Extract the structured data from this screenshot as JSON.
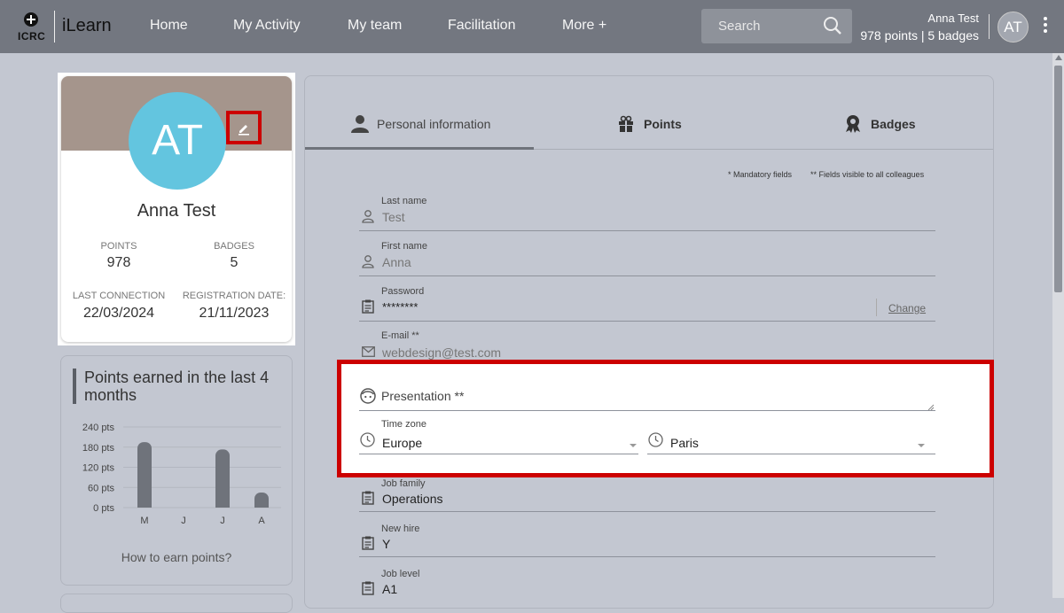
{
  "header": {
    "logo_text": "ICRC",
    "app_name": "iLearn",
    "nav": [
      "Home",
      "My Activity",
      "My team",
      "Facilitation",
      "More +"
    ],
    "search_placeholder": "Search",
    "user_name": "Anna Test",
    "user_stats": "978 points | 5 badges",
    "user_initials": "AT"
  },
  "profile": {
    "initials": "AT",
    "name": "Anna Test",
    "points_label": "POINTS",
    "points_value": "978",
    "badges_label": "BADGES",
    "badges_value": "5",
    "last_connection_label": "LAST CONNECTION",
    "last_connection_value": "22/03/2024",
    "registration_label": "REGISTRATION DATE:",
    "registration_value": "21/11/2023"
  },
  "points_widget": {
    "title": "Points earned in the last 4 months",
    "link": "How to earn points?"
  },
  "chart_data": {
    "type": "bar",
    "categories": [
      "M",
      "J",
      "J",
      "A"
    ],
    "values": [
      195,
      0,
      173,
      45
    ],
    "ylim": [
      0,
      240
    ],
    "yticks": [
      "240 pts",
      "180 pts",
      "120 pts",
      "60 pts",
      "0 pts"
    ],
    "bar_color": "#6f737b"
  },
  "tabs": [
    {
      "label": "Personal information",
      "icon": "person-icon"
    },
    {
      "label": "Points",
      "icon": "gift-icon"
    },
    {
      "label": "Badges",
      "icon": "award-icon"
    }
  ],
  "legend": {
    "mandatory": "* Mandatory fields",
    "visible": "** Fields visible to all colleagues"
  },
  "form": {
    "last_name_label": "Last name",
    "last_name_value": "Test",
    "first_name_label": "First name",
    "first_name_value": "Anna",
    "password_label": "Password",
    "password_value": "********",
    "change_label": "Change",
    "email_label": "E-mail **",
    "email_value": "webdesign@test.com",
    "presentation_label": "Presentation **",
    "timezone_label": "Time zone",
    "timezone_region": "Europe",
    "timezone_city": "Paris",
    "job_family_label": "Job family",
    "job_family_value": "Operations",
    "new_hire_label": "New hire",
    "new_hire_value": "Y",
    "job_level_label": "Job level",
    "job_level_value": "A1"
  }
}
